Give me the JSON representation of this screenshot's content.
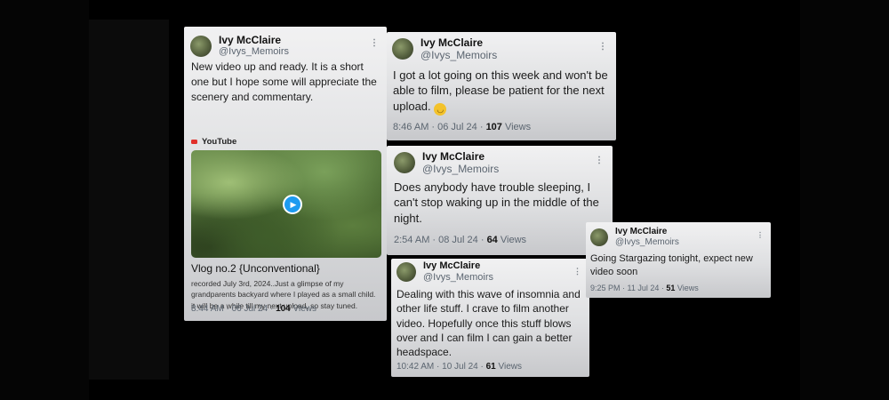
{
  "author": {
    "name": "Ivy McClaire",
    "handle": "@Ivys_Memoirs"
  },
  "tweets": [
    {
      "text": "New video up and ready. It is a short one but I hope some will appreciate the scenery and commentary.",
      "card": {
        "source": "YouTube",
        "title": "Vlog no.2 {Unconventional}",
        "description": "recorded July 3rd, 2024..Just a glimpse of my grandparents backyard where I played as a small child. it will be a while till my next upload, so stay tuned."
      },
      "timestamp": "8:44 AM · 06 Jul 24 · ",
      "views": "104",
      "views_label": " Views"
    },
    {
      "text": "I got a lot going on this week and won't be able to film, please be patient for the next upload.",
      "emoji": "🙂",
      "timestamp": "8:46 AM · 06 Jul 24 · ",
      "views": "107",
      "views_label": " Views"
    },
    {
      "text": "Does anybody have trouble sleeping, I can't stop waking up in the middle of the night.",
      "timestamp": "2:54 AM · 08 Jul 24 · ",
      "views": "64",
      "views_label": " Views"
    },
    {
      "text": "Dealing with this wave of insomnia and other life stuff. I crave to film another video. Hopefully once this stuff blows over and I can film I can gain a better headspace.",
      "timestamp": "10:42 AM · 10 Jul 24 · ",
      "views": "61",
      "views_label": " Views"
    },
    {
      "text": "Going Stargazing tonight, expect new video soon",
      "timestamp": "9:25 PM · 11 Jul 24 · ",
      "views": "51",
      "views_label": " Views"
    }
  ],
  "icons": {
    "menu": "more-dots-icon",
    "play": "play-icon",
    "source_logo": "youtube-logo-icon"
  },
  "colors": {
    "background": "#000000",
    "card": "#e4e5e7",
    "play_button": "#1d9bf0",
    "youtube_red": "#e1302a"
  }
}
